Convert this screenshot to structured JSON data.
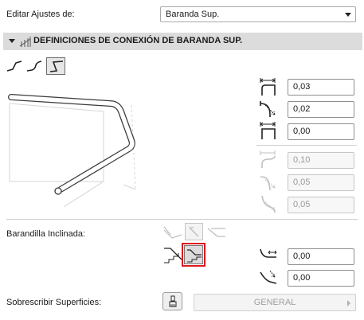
{
  "edit_settings": {
    "label": "Editar Ajustes de:",
    "selected": "Baranda Sup."
  },
  "section": {
    "title": "DEFINICIONES DE CONEXIÓN DE BARANDA SUP.",
    "connection_types": [
      "straight-connection",
      "curved-connection",
      "bent-connection (selected)"
    ]
  },
  "fields": {
    "f1": "0,03",
    "f2": "0,02",
    "f3": "0,00",
    "f4": "0,10",
    "f5": "0,05",
    "f6": "0,05"
  },
  "inclined": {
    "label": "Barandilla Inclinada:",
    "f1": "0,00",
    "f2": "0,00"
  },
  "override": {
    "label": "Sobrescribir Superficies:",
    "surface": "GENERAL"
  },
  "colors": {
    "highlight": "#e0161b",
    "section_bg": "#dcdcdc"
  }
}
